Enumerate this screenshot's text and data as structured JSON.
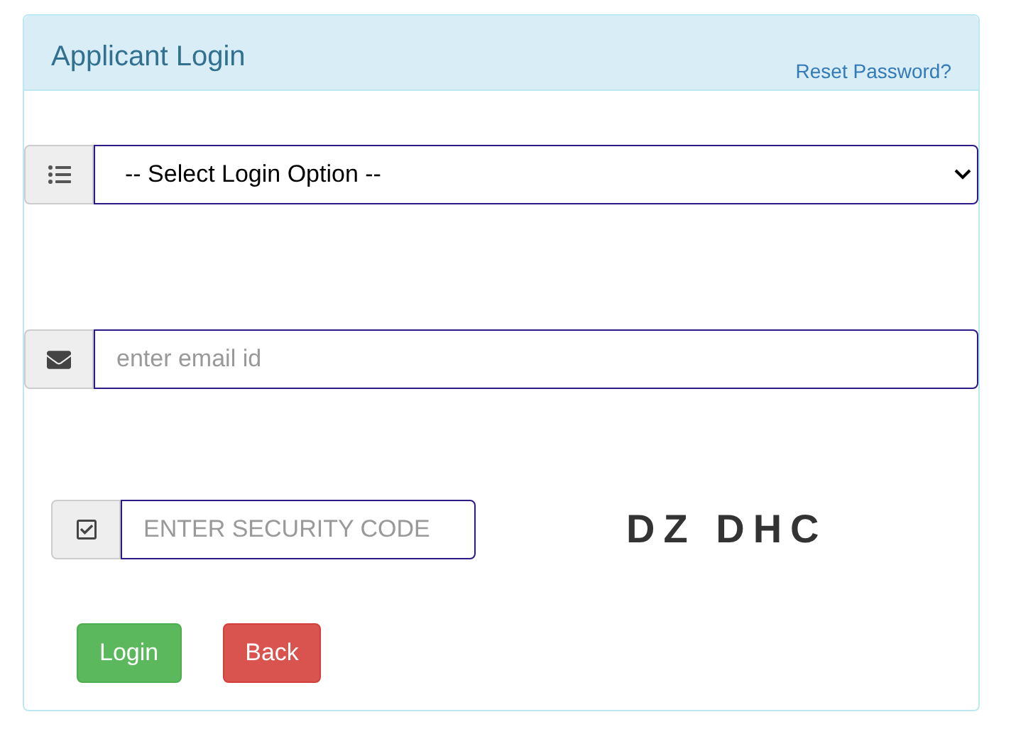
{
  "panel": {
    "title": "Applicant Login",
    "reset_link": "Reset Password?"
  },
  "login_option": {
    "value": "-- Select Login Option --"
  },
  "email": {
    "placeholder": "enter email id"
  },
  "security_code": {
    "placeholder": "ENTER SECURITY CODE"
  },
  "captcha": "DZ DHC",
  "buttons": [
    {
      "label": "Login",
      "kind": "success"
    },
    {
      "label": "Back",
      "kind": "danger"
    }
  ]
}
